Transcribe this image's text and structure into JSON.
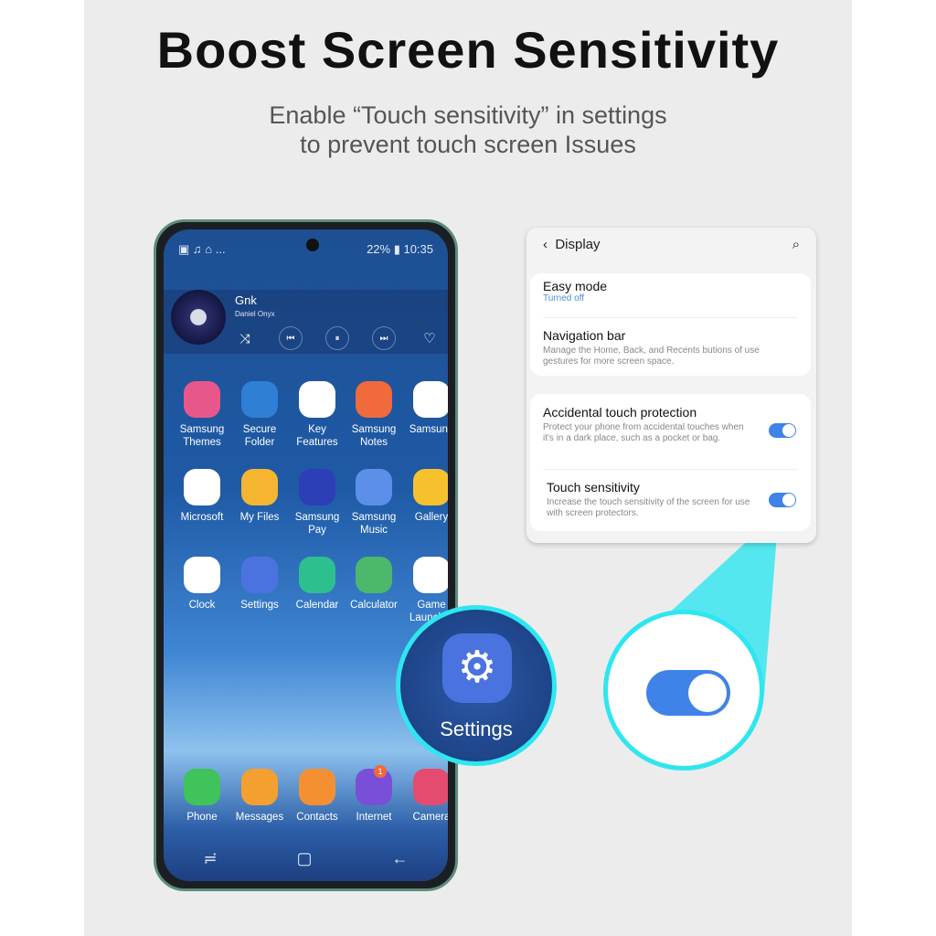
{
  "headline": "Boost Screen Sensitivity",
  "subtitle_line1": "Enable “Touch sensitivity” in settings",
  "subtitle_line2": "to prevent touch screen Issues",
  "phone": {
    "status_left": "▣ ♫ ⌂ ...",
    "status_right": "22% ▮ 10:35",
    "media": {
      "song": "Gnk",
      "artist": "Daniel Onyx"
    },
    "apps": [
      {
        "label": "Samsung Themes",
        "color": "#e8578a"
      },
      {
        "label": "Secure Folder",
        "color": "#2f7fd6"
      },
      {
        "label": "Key Features",
        "color": "#ffffff"
      },
      {
        "label": "Samsung Notes",
        "color": "#f06a3b"
      },
      {
        "label": "Samsung",
        "color": "#ffffff"
      },
      {
        "label": "Microsoft",
        "color": "#ffffff"
      },
      {
        "label": "My Files",
        "color": "#f5b531"
      },
      {
        "label": "Samsung Pay",
        "color": "#2d3fb6"
      },
      {
        "label": "Samsung Music",
        "color": "#5b8fe8"
      },
      {
        "label": "Gallery",
        "color": "#f7c12e"
      },
      {
        "label": "Clock",
        "color": "#ffffff"
      },
      {
        "label": "Settings",
        "color": "#4a73e0"
      },
      {
        "label": "Calendar",
        "color": "#2ebf8f"
      },
      {
        "label": "Calculator",
        "color": "#4cb86b"
      },
      {
        "label": "Game Launcher",
        "color": "#ffffff"
      }
    ],
    "dock": [
      {
        "label": "Phone",
        "color": "#3fc35a"
      },
      {
        "label": "Messages",
        "color": "#f4a030"
      },
      {
        "label": "Contacts",
        "color": "#f49032"
      },
      {
        "label": "Internet",
        "color": "#7a4fd8",
        "badge": "1"
      },
      {
        "label": "Camera",
        "color": "#e44b6f"
      }
    ],
    "game_badge": "1"
  },
  "settings_callout": {
    "label": "Settings"
  },
  "display_panel": {
    "title": "Display",
    "items": [
      {
        "title": "Easy mode",
        "desc": "Turned off"
      },
      {
        "title": "Navigation bar",
        "desc": "Manage the Home, Back, and Recents butions of use gestures for more screen space."
      },
      {
        "title": "Accidental touch protection",
        "desc": "Protect your phone from accidental touches when it's in a dark place, such as a pocket or bag.",
        "on": true
      },
      {
        "title": "Touch sensitivity",
        "desc": "Increase the touch sensitivity of the screen for use with screen protectors.",
        "on": true
      }
    ]
  },
  "colors": {
    "accent": "#3f83e8",
    "highlight": "#2ee6f0"
  }
}
